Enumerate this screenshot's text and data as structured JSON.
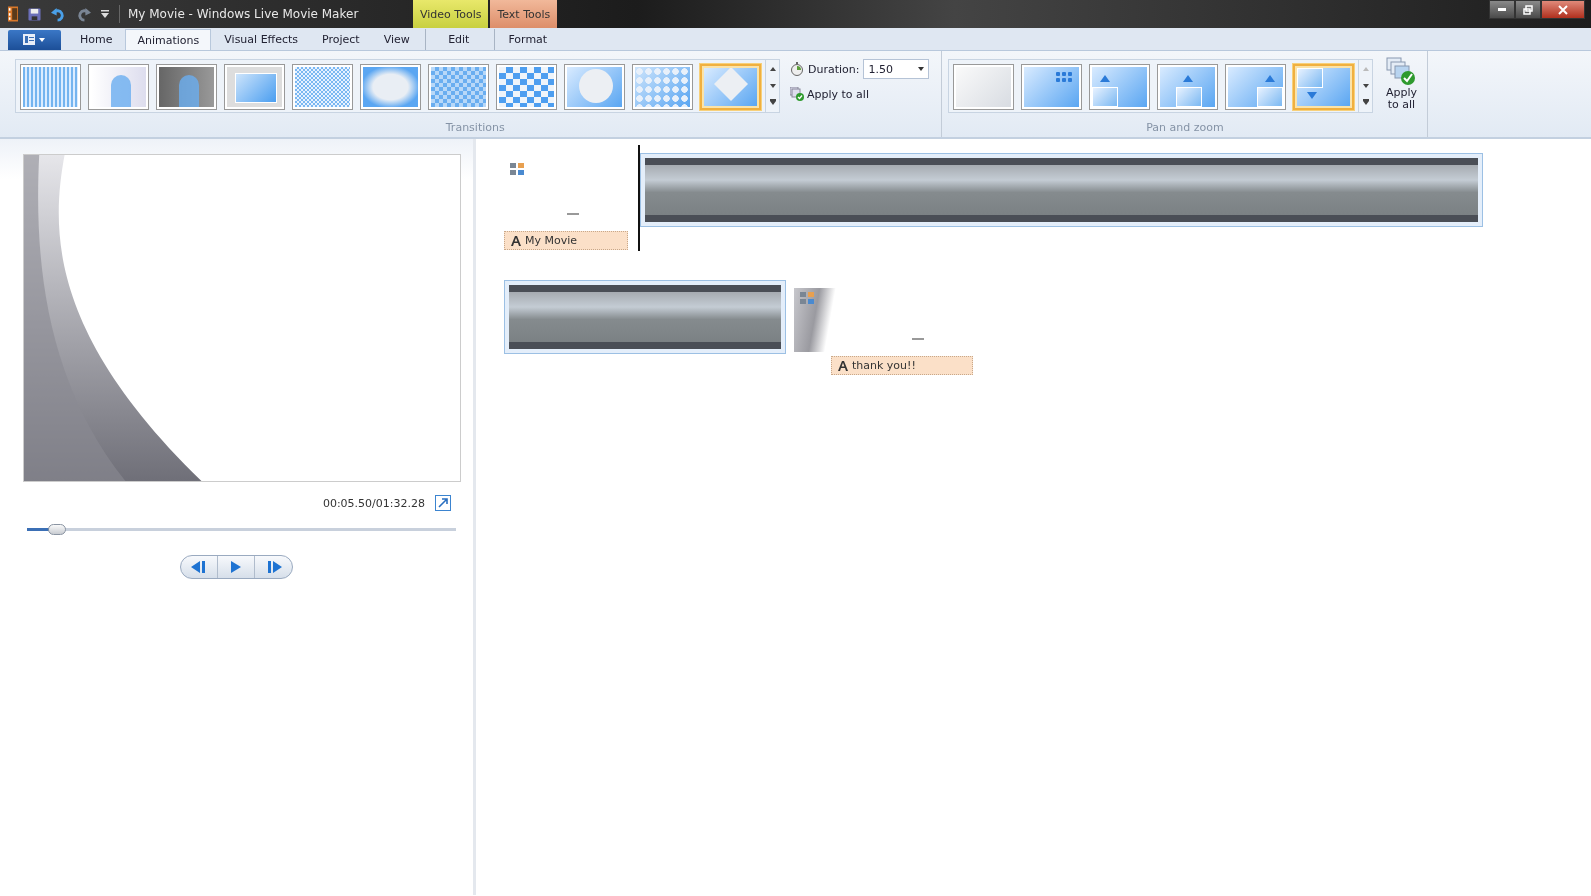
{
  "window": {
    "title": "My Movie - Windows Live Movie Maker"
  },
  "context_tabs": [
    {
      "label": "Video Tools",
      "kind": "video"
    },
    {
      "label": "Text Tools",
      "kind": "text"
    }
  ],
  "tabs": [
    {
      "label": "Home",
      "kind": "main",
      "selected": false
    },
    {
      "label": "Animations",
      "kind": "main",
      "selected": true
    },
    {
      "label": "Visual Effects",
      "kind": "main",
      "selected": false
    },
    {
      "label": "Project",
      "kind": "main",
      "selected": false
    },
    {
      "label": "View",
      "kind": "main",
      "selected": false
    },
    {
      "label": "Edit",
      "kind": "video",
      "selected": false
    },
    {
      "label": "Format",
      "kind": "text",
      "selected": false
    }
  ],
  "ribbon": {
    "transitions": {
      "label": "Transitions",
      "items": [
        {
          "kind": "bars",
          "selected": false
        },
        {
          "kind": "fade-white",
          "selected": false
        },
        {
          "kind": "fade-black",
          "selected": false
        },
        {
          "kind": "zoom",
          "selected": false
        },
        {
          "kind": "dissolve",
          "selected": false
        },
        {
          "kind": "shatter",
          "selected": false
        },
        {
          "kind": "mosaic",
          "selected": false
        },
        {
          "kind": "checker",
          "selected": false
        },
        {
          "kind": "circle",
          "selected": false
        },
        {
          "kind": "dots",
          "selected": false
        },
        {
          "kind": "diamond",
          "selected": true
        }
      ],
      "duration": {
        "label": "Duration:",
        "value": "1.50"
      },
      "apply_all": "Apply to all"
    },
    "pan_zoom": {
      "label": "Pan and zoom",
      "items": [
        {
          "kind": "none",
          "selected": false
        },
        {
          "kind": "zoom-in",
          "selected": false
        },
        {
          "kind": "pan-up-left",
          "selected": false
        },
        {
          "kind": "pan-up",
          "selected": false
        },
        {
          "kind": "pan-up-right",
          "selected": false
        },
        {
          "kind": "pan-down",
          "selected": true
        }
      ],
      "apply_all": "Apply to all"
    }
  },
  "preview": {
    "time": "00:05.50/01:32.28",
    "seek": {
      "level": 0.07
    }
  },
  "storyboard": {
    "rows": [
      [
        {
          "kind": "title",
          "caption": "My Movie"
        },
        {
          "kind": "video",
          "selected": true,
          "playhead": true
        }
      ],
      [
        {
          "kind": "video",
          "selected": true
        },
        {
          "kind": "title",
          "caption": "thank you!!"
        }
      ]
    ]
  }
}
